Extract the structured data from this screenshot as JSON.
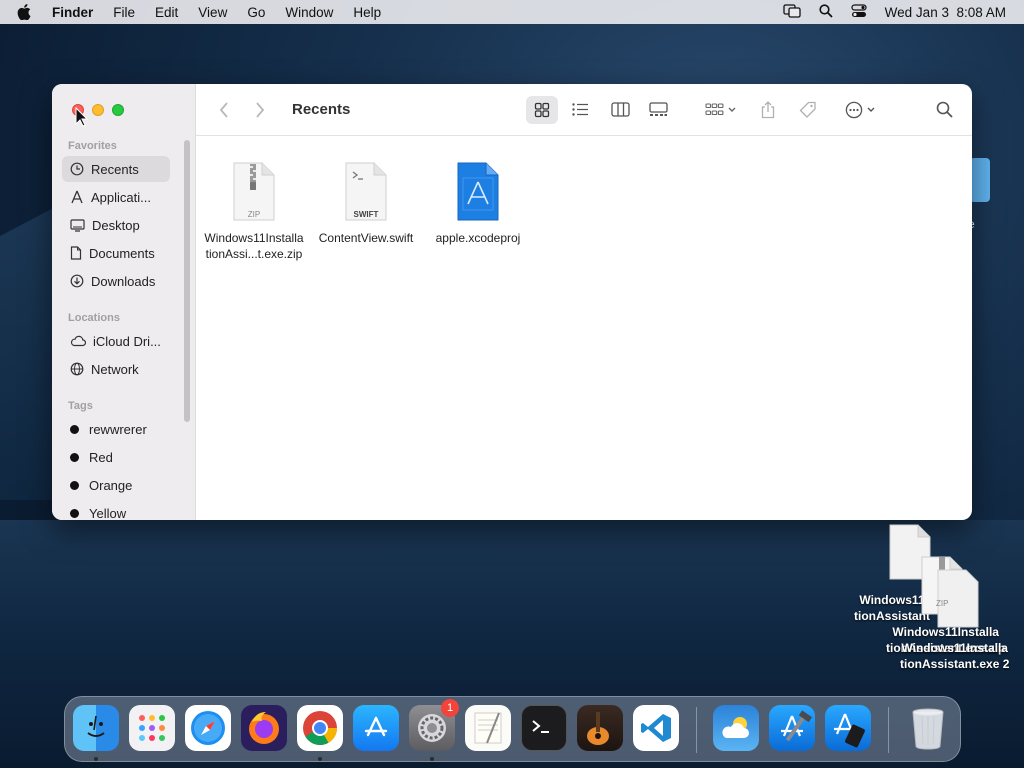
{
  "menubar": {
    "app_name": "Finder",
    "items": [
      "File",
      "Edit",
      "View",
      "Go",
      "Window",
      "Help"
    ],
    "datetime": "Wed Jan 3  8:08 AM",
    "status_icons": [
      "window-mirror-icon",
      "search-icon",
      "control-center-icon"
    ]
  },
  "finder": {
    "title": "Recents",
    "view_modes": [
      "icon-view",
      "list-view",
      "column-view",
      "gallery-view"
    ],
    "active_view": "icon-view",
    "sidebar": {
      "favorites_header": "Favorites",
      "favorites": [
        {
          "label": "Recents",
          "icon": "clock-icon",
          "selected": true
        },
        {
          "label": "Applicati...",
          "icon": "applications-icon"
        },
        {
          "label": "Desktop",
          "icon": "desktop-icon"
        },
        {
          "label": "Documents",
          "icon": "document-icon"
        },
        {
          "label": "Downloads",
          "icon": "download-icon"
        }
      ],
      "locations_header": "Locations",
      "locations": [
        {
          "label": "iCloud Dri...",
          "icon": "cloud-icon"
        },
        {
          "label": "Network",
          "icon": "globe-icon"
        }
      ],
      "tags_header": "Tags",
      "tags": [
        {
          "label": "rewwrerer",
          "color": "#111111"
        },
        {
          "label": "Red",
          "color": "#111111"
        },
        {
          "label": "Orange",
          "color": "#111111"
        },
        {
          "label": "Yellow",
          "color": "#111111"
        }
      ]
    },
    "files": [
      {
        "line1": "Windows11Installa",
        "line2": "tionAssi...t.exe.zip",
        "badge": "ZIP",
        "icon": "zip-file-icon"
      },
      {
        "line1": "ContentView.swift",
        "line2": "",
        "badge": "SWIFT",
        "icon": "swift-file-icon"
      },
      {
        "line1": "apple.xcodeproj",
        "line2": "",
        "badge": "",
        "icon": "xcodeproj-icon"
      }
    ]
  },
  "desktop": {
    "partial_label": "e",
    "items": [
      {
        "lines": [
          "Windows11",
          "tionAssistant"
        ],
        "icon": "document-icon"
      },
      {
        "lines": [
          "Windows11Installa",
          "tionAssistant.exe.zip"
        ],
        "badge": "ZIP",
        "icon": "zip-file-icon"
      },
      {
        "lines": [
          "Windows11Installa",
          "tionAssistant.exe 2"
        ],
        "icon": "document-icon"
      }
    ]
  },
  "dock": {
    "apps": [
      {
        "name": "Finder",
        "icon": "finder-icon",
        "running": true
      },
      {
        "name": "Launchpad",
        "icon": "launchpad-icon"
      },
      {
        "name": "Safari",
        "icon": "safari-icon"
      },
      {
        "name": "Firefox",
        "icon": "firefox-icon"
      },
      {
        "name": "Chrome",
        "icon": "chrome-icon",
        "running": true
      },
      {
        "name": "App Store",
        "icon": "app-store-icon"
      },
      {
        "name": "System Settings",
        "icon": "settings-icon",
        "badge": "1",
        "running": true
      },
      {
        "name": "TextEdit",
        "icon": "textedit-icon"
      },
      {
        "name": "Terminal",
        "icon": "terminal-icon"
      },
      {
        "name": "GarageBand",
        "icon": "garageband-icon"
      },
      {
        "name": "Visual Studio Code",
        "icon": "vscode-icon"
      },
      {
        "name": "Weather",
        "icon": "weather-icon"
      },
      {
        "name": "Xcode",
        "icon": "xcode-icon"
      },
      {
        "name": "Simulator",
        "icon": "simulator-icon"
      },
      {
        "name": "Trash",
        "icon": "trash-icon"
      }
    ],
    "badge_text": "1"
  }
}
